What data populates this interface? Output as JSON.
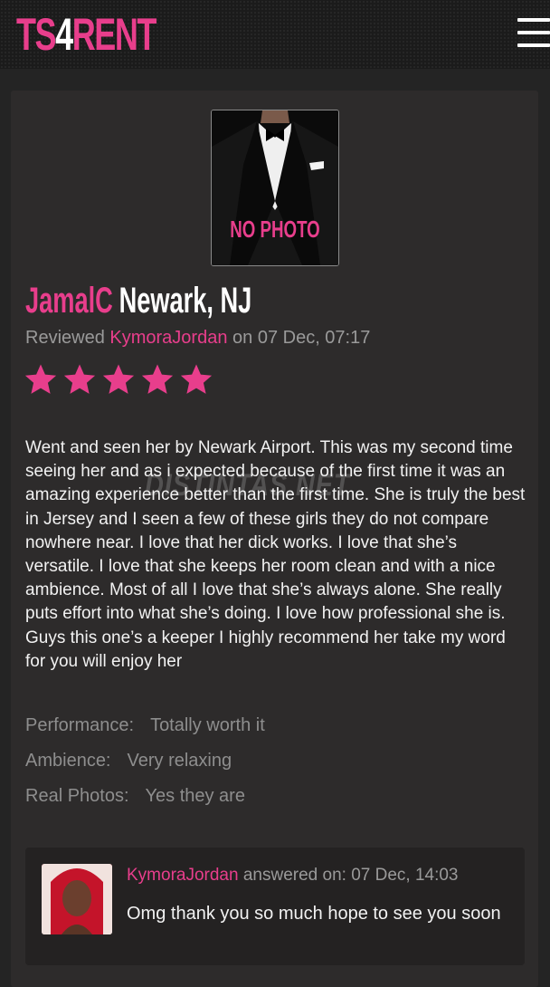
{
  "header": {
    "logo_part1": "TS",
    "logo_part2": "4",
    "logo_part3": "RENT",
    "menu_icon": "hamburger-menu-icon"
  },
  "review": {
    "photo_label": "NO PHOTO",
    "reviewer_name": "JamalC",
    "location": "Newark, NJ",
    "reviewed_label": "Reviewed",
    "reviewed_user": "KymoraJordan",
    "reviewed_date": "on 07 Dec, 07:17",
    "rating": 5,
    "rating_max": 5,
    "text": "Went and seen her by Newark Airport. This was my second time seeing her and as i expected because of the first time it was an amazing experience better than the first time. She is truly the best in Jersey and I seen a few of these girls they do not compare nowhere near. I love that her dick works. I love that she’s versatile. I love that she keeps her room clean and with a nice ambience. Most of all I love that she’s always alone. She really puts effort into what she’s doing. I love how professional she is. Guys this one’s a keeper I highly recommend her take my word for you will enjoy her",
    "watermark": "DISTINTAS.NET",
    "attributes": [
      {
        "label": "Performance:",
        "value": "Totally worth it"
      },
      {
        "label": "Ambience:",
        "value": "Very relaxing"
      },
      {
        "label": "Real Photos:",
        "value": "Yes they are"
      }
    ]
  },
  "reply": {
    "author": "KymoraJordan",
    "answered_label": "answered on: 07 Dec, 14:03",
    "text": "Omg thank you so much hope to see you soon"
  },
  "colors": {
    "accent": "#e83e8c",
    "background": "#242424",
    "card": "#2d2b2b"
  }
}
